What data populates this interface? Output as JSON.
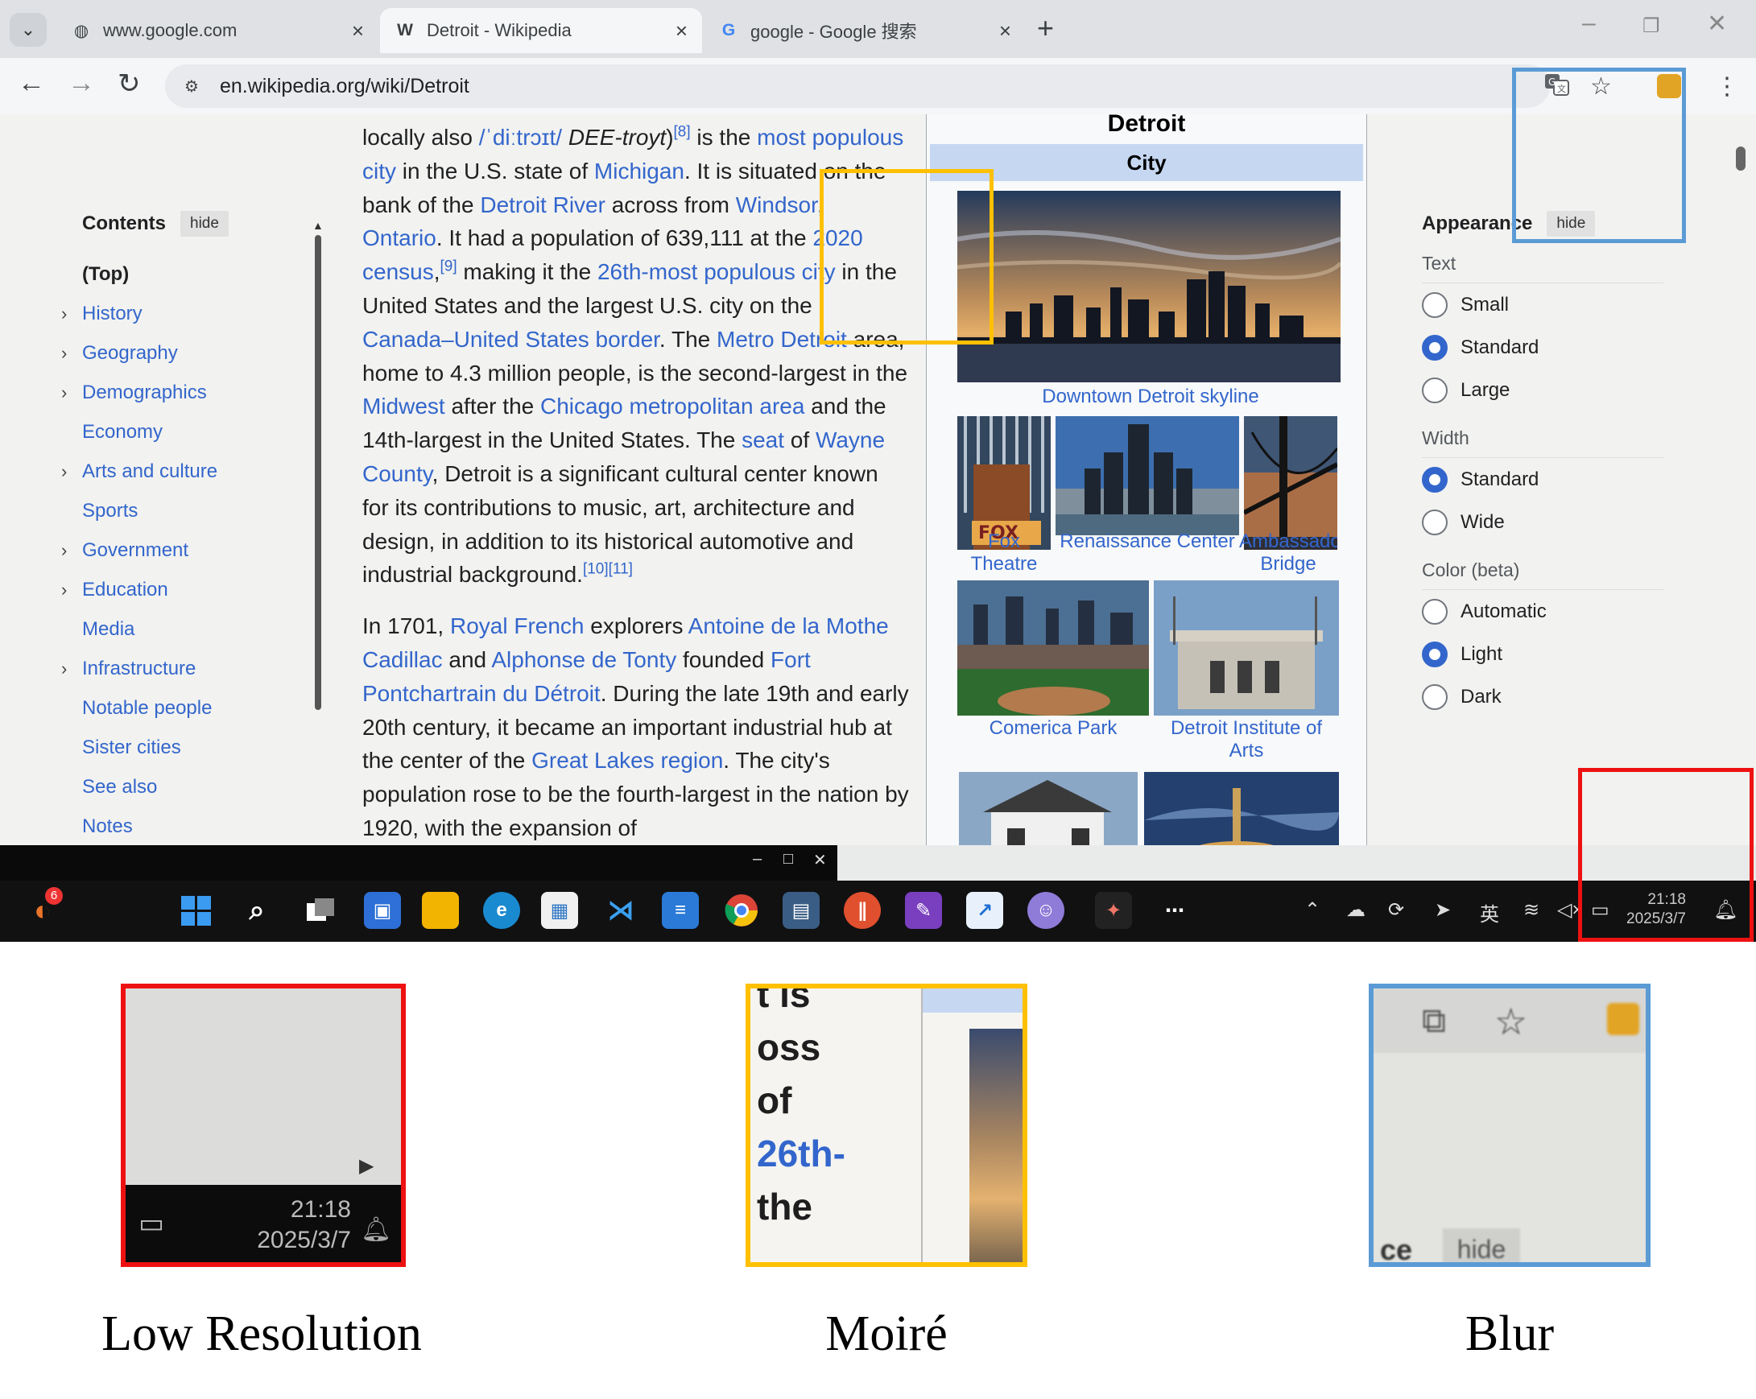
{
  "browser": {
    "tabs": [
      {
        "favicon": "globe-icon",
        "title": "www.google.com",
        "active": false
      },
      {
        "favicon": "W",
        "title": "Detroit - Wikipedia",
        "active": true
      },
      {
        "favicon": "G",
        "title": "google - Google 搜索",
        "active": false
      }
    ],
    "url": "en.wikipedia.org/wiki/Detroit"
  },
  "toc": {
    "heading": "Contents",
    "hide_label": "hide",
    "items": [
      {
        "label": "(Top)",
        "expandable": false
      },
      {
        "label": "History",
        "expandable": true
      },
      {
        "label": "Geography",
        "expandable": true
      },
      {
        "label": "Demographics",
        "expandable": true
      },
      {
        "label": "Economy",
        "expandable": false
      },
      {
        "label": "Arts and culture",
        "expandable": true
      },
      {
        "label": "Sports",
        "expandable": false
      },
      {
        "label": "Government",
        "expandable": true
      },
      {
        "label": "Education",
        "expandable": true
      },
      {
        "label": "Media",
        "expandable": false
      },
      {
        "label": "Infrastructure",
        "expandable": true
      },
      {
        "label": "Notable people",
        "expandable": false
      },
      {
        "label": "Sister cities",
        "expandable": false
      },
      {
        "label": "See also",
        "expandable": false
      },
      {
        "label": "Notes",
        "expandable": false
      }
    ]
  },
  "article": {
    "p1": [
      {
        "t": "locally also "
      },
      {
        "t": "/ˈdiːtrɔɪt/",
        "link": true
      },
      {
        "t": " DEE-troyt",
        "italic": true
      },
      {
        "t": ")"
      },
      {
        "t": "[8]",
        "sup": true
      },
      {
        "t": " is the "
      },
      {
        "t": "most populous city",
        "link": true
      },
      {
        "t": " in the U.S. state of "
      },
      {
        "t": "Michigan",
        "link": true
      },
      {
        "t": ". It is situated on the bank of the "
      },
      {
        "t": "Detroit River",
        "link": true
      },
      {
        "t": " across from "
      },
      {
        "t": "Windsor, Ontario",
        "link": true
      },
      {
        "t": ". It had a population of 639,111 at the "
      },
      {
        "t": "2020 census",
        "link": true
      },
      {
        "t": ","
      },
      {
        "t": "[9]",
        "sup": true
      },
      {
        "t": " making it the "
      },
      {
        "t": "26th-most populous city",
        "link": true
      },
      {
        "t": " in the United States and the largest U.S. city on the "
      },
      {
        "t": "Canada–United States border",
        "link": true
      },
      {
        "t": ". The "
      },
      {
        "t": "Metro Detroit",
        "link": true
      },
      {
        "t": " area, home to 4.3 million people, is the second-largest in the "
      },
      {
        "t": "Midwest",
        "link": true
      },
      {
        "t": " after the "
      },
      {
        "t": "Chicago metropolitan area",
        "link": true
      },
      {
        "t": " and the 14th-largest in the United States. The "
      },
      {
        "t": "seat",
        "link": true
      },
      {
        "t": " of "
      },
      {
        "t": "Wayne County",
        "link": true
      },
      {
        "t": ", Detroit is a significant cultural center known for its contributions to music, art, architecture and design, in addition to its historical automotive and industrial background."
      },
      {
        "t": "[10][11]",
        "sup": true
      }
    ],
    "p2": [
      {
        "t": "In 1701, "
      },
      {
        "t": "Royal French",
        "link": true
      },
      {
        "t": " explorers "
      },
      {
        "t": "Antoine de la Mothe Cadillac",
        "link": true
      },
      {
        "t": " and "
      },
      {
        "t": "Alphonse de Tonty",
        "link": true
      },
      {
        "t": " founded "
      },
      {
        "t": "Fort Pontchartrain du Détroit",
        "link": true
      },
      {
        "t": ". During the late 19th and early 20th century, it became an important industrial hub at the center of the "
      },
      {
        "t": "Great Lakes region",
        "link": true
      },
      {
        "t": ". The city's population rose to be the fourth-"
      },
      {
        "t": "largest in the nation by 1920, with the expansion of"
      }
    ]
  },
  "infobox": {
    "title": "Detroit",
    "subtitle": "City",
    "captions": {
      "skyline": "Downtown Detroit skyline",
      "fox": "Fox Theatre",
      "renaissance": "Renaissance Center",
      "ambassador": "Ambassador Bridge",
      "comerica": "Comerica Park",
      "dia": "Detroit Institute of Arts"
    }
  },
  "appearance": {
    "heading": "Appearance",
    "hide_label": "hide",
    "groups": [
      {
        "label": "Text",
        "options": [
          {
            "label": "Small",
            "checked": false
          },
          {
            "label": "Standard",
            "checked": true
          },
          {
            "label": "Large",
            "checked": false
          }
        ]
      },
      {
        "label": "Width",
        "options": [
          {
            "label": "Standard",
            "checked": true
          },
          {
            "label": "Wide",
            "checked": false
          }
        ]
      },
      {
        "label": "Color (beta)",
        "options": [
          {
            "label": "Automatic",
            "checked": false
          },
          {
            "label": "Light",
            "checked": true
          },
          {
            "label": "Dark",
            "checked": false
          }
        ]
      }
    ]
  },
  "taskbar": {
    "badge": "6",
    "ime": "英",
    "time": "21:18",
    "date": "2025/3/7"
  },
  "insets": {
    "low_res": {
      "label": "Low Resolution",
      "time": "21:18",
      "date": "2025/3/7",
      "color": "#ee1111"
    },
    "moire": {
      "label": "Moiré",
      "fragments": [
        "t is",
        "oss",
        "of",
        "26th-",
        "the"
      ],
      "color": "#ffc000"
    },
    "blur": {
      "label": "Blur",
      "fragment": "ce",
      "hide_label": "hide",
      "color": "#5b9bd5"
    }
  }
}
